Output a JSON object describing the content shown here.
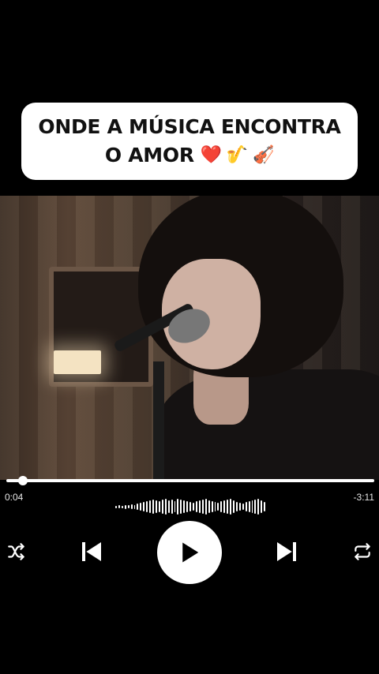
{
  "caption": {
    "line1": "ONDE A MÚSICA ENCONTRA",
    "line2": "O AMOR",
    "emojis": [
      "❤️",
      "🎷",
      "🎻"
    ]
  },
  "player": {
    "elapsed": "0:04",
    "remaining": "-3:11",
    "progress_fraction": 0.02
  },
  "icons": {
    "shuffle": "shuffle-icon",
    "previous": "skip-previous-icon",
    "play": "play-icon",
    "next": "skip-next-icon",
    "repeat": "repeat-icon"
  }
}
